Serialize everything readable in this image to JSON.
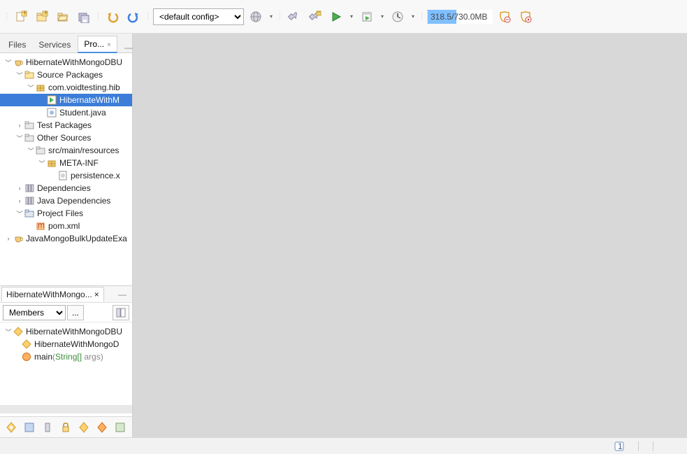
{
  "toolbar": {
    "config_select": "<default config>",
    "memory": "318.5/730.0MB"
  },
  "sidebar": {
    "tabs": [
      "Files",
      "Services",
      "Pro..."
    ],
    "active_tab_index": 2,
    "tree": {
      "n0": "HibernateWithMongoDBU",
      "n1": "Source Packages",
      "n2": "com.voidtesting.hib",
      "n3": "HibernateWithM",
      "n4": "Student.java",
      "n5": "Test Packages",
      "n6": "Other Sources",
      "n7": "src/main/resources",
      "n8": "META-INF",
      "n9": "persistence.x",
      "n10": "Dependencies",
      "n11": "Java Dependencies",
      "n12": "Project Files",
      "n13": "pom.xml",
      "n14": "JavaMongoBulkUpdateExa"
    }
  },
  "navigator": {
    "tab_title": "HibernateWithMongo...",
    "filter_label": "Members",
    "btn_dots": "...",
    "tree": {
      "root": "HibernateWithMongoDBU",
      "ctor": "HibernateWithMongoD",
      "main_name": "main",
      "main_type": "String[]",
      "main_suffix": " args)"
    }
  },
  "status": {
    "indicator": "1"
  }
}
